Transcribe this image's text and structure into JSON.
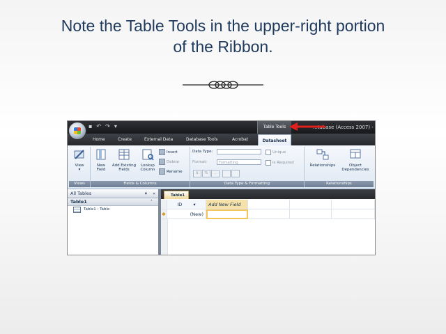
{
  "slide": {
    "title_line1": "Note the Table Tools in the upper-right portion",
    "title_line2": "of the Ribbon."
  },
  "window": {
    "context_tab": "Table Tools",
    "app_title": "...tabase (Access 2007) -"
  },
  "ribbon_tabs": [
    "Home",
    "Create",
    "External Data",
    "Database Tools",
    "Acrobat",
    "Datasheet"
  ],
  "ribbon": {
    "views_group": {
      "label": "Views",
      "view_btn_l1": "View",
      "view_btn_l2": "▾"
    },
    "fields_group": {
      "label": "Fields & Columns",
      "new_field_l1": "New",
      "new_field_l2": "Field",
      "add_existing_l1": "Add Existing",
      "add_existing_l2": "Fields",
      "lookup_l1": "Lookup",
      "lookup_l2": "Column",
      "insert": "Insert",
      "delete": "Delete",
      "rename": "Rename"
    },
    "datatype_group": {
      "label": "Data Type & Formatting",
      "data_type_label": "Data Type:",
      "format_label": "Format:",
      "format_placeholder": "Formatting",
      "unique": "Unique",
      "is_required": "Is Required",
      "currency": "$",
      "percent": "%",
      "comma": ","
    },
    "relationships_group": {
      "label": "Relationships",
      "relationships_btn": "Relationships",
      "object_dep_l1": "Object",
      "object_dep_l2": "Dependencies"
    }
  },
  "nav_pane": {
    "header": "All Tables",
    "group": "Table1",
    "item": "Table1 : Table"
  },
  "datasheet": {
    "tab": "Table1",
    "col_id": "ID",
    "col_new": "Add New Field",
    "new_row": "(New)"
  },
  "colors": {
    "title": "#1f3a5c",
    "arrow": "#e0201c",
    "active_tab": "#ffffff",
    "highlight": "#f4c65a"
  }
}
